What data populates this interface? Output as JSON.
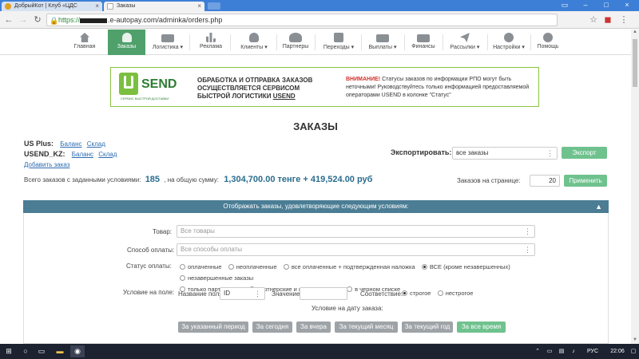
{
  "browser": {
    "tabs": [
      {
        "title": "ДобрыйКот | Клуб «ЦДС",
        "active": false
      },
      {
        "title": "Заказы",
        "active": true
      }
    ],
    "url_scheme": "https://",
    "url_rest": ".e-autopay.com/adminka/orders.php"
  },
  "nav": [
    {
      "label": "Главная",
      "icon": "home-icon",
      "active": false
    },
    {
      "label": "Заказы",
      "icon": "cart-icon",
      "active": true
    },
    {
      "label": "Логистика ▾",
      "icon": "truck-icon",
      "active": false
    },
    {
      "label": "Реклама",
      "icon": "bar-chart-icon",
      "active": false
    },
    {
      "label": "Клиенты ▾",
      "icon": "user-icon",
      "active": false
    },
    {
      "label": "Партнеры",
      "icon": "users-icon",
      "active": false
    },
    {
      "label": "Переходы ▾",
      "icon": "share-icon",
      "active": false
    },
    {
      "label": "Выплаты ▾",
      "icon": "credit-card-icon",
      "active": false
    },
    {
      "label": "Финансы",
      "icon": "money-icon",
      "active": false
    },
    {
      "label": "Рассылки ▾",
      "icon": "send-icon",
      "active": false
    },
    {
      "label": "Настройки ▾",
      "icon": "gear-icon",
      "active": false
    },
    {
      "label": "Помощь",
      "icon": "help-icon",
      "active": false
    }
  ],
  "banner": {
    "logo_text": "SEND",
    "logo_sub": "СЕРВИС БЫСТРОЙ ДОСТАВКИ",
    "main_line1": "ОБРАБОТКА И ОТПРАВКА ЗАКАЗОВ",
    "main_line2": "ОСУЩЕСТВЛЯЕТСЯ СЕРВИСОМ",
    "main_line3": "БЫСТРОЙ ЛОГИСТИКИ",
    "main_usend": "USEND",
    "warn_title": "ВНИМАНИЕ!",
    "warn_text": " Статусы заказов по информации РПО могут быть неточными! Руководствуйтесь только информацией предоставляемой операторами USEND в колонке \"Статус\""
  },
  "page": {
    "title": "ЗАКАЗЫ",
    "us_plus_label": "US Plus:",
    "usend_kz_label": "USEND_KZ:",
    "balance": "Баланс",
    "warehouse": "Склад",
    "add_order": "Добавить заказ",
    "export_label": "Экспортировать:",
    "export_value": "все заказы",
    "export_button": "Экспорт",
    "totals_prefix": "Всего заказов с заданными условиями:",
    "totals_count": "185",
    "totals_mid": ", на общую сумму:",
    "totals_sum": "1,304,700.00 тенге + 419,524.00 руб",
    "per_page_label": "Заказов на странице:",
    "per_page_value": "20",
    "apply_button": "Применить"
  },
  "filter": {
    "header": "Отображать заказы, удовлетворяющие следующим условиям:",
    "product_label": "Товар:",
    "product_placeholder": "Все товары",
    "payment_label": "Способ оплаты:",
    "payment_placeholder": "Все способы оплаты",
    "status_label": "Статус оплаты:",
    "status_options": [
      {
        "label": "оплаченные",
        "checked": false
      },
      {
        "label": "неоплаченные",
        "checked": false
      },
      {
        "label": "все оплаченные + подтвержденная наложка",
        "checked": false
      },
      {
        "label": "ВСЕ (кроме незавершенных)",
        "checked": true
      },
      {
        "label": "незавершенные заказы",
        "checked": false
      },
      {
        "label": "только партнерские",
        "checked": false
      },
      {
        "label": "партнерские и непартнерские",
        "checked": false
      },
      {
        "label": "в черном списке",
        "checked": false
      }
    ],
    "field_cond_label": "Условие на поле:",
    "field_name_label": "Название поля",
    "field_name_value": "ID",
    "value_label": "Значение",
    "match_label": "Соответствие:",
    "match_options": [
      {
        "label": "строгое",
        "checked": true
      },
      {
        "label": "нестрогое",
        "checked": false
      }
    ],
    "date_cond_label": "Условие на дату заказа:",
    "date_buttons": [
      {
        "label": "За указанный период",
        "active": false
      },
      {
        "label": "За сегодня",
        "active": false
      },
      {
        "label": "За вчера",
        "active": false
      },
      {
        "label": "За текущий месяц",
        "active": false
      },
      {
        "label": "За текущий год",
        "active": false
      },
      {
        "label": "За все время",
        "active": true
      }
    ]
  },
  "taskbar": {
    "lang": "РУС",
    "time": "22:06"
  },
  "colors": {
    "accent_green": "#4fa06a",
    "filter_header": "#4b7d94",
    "totals_blue": "#2b6c8f",
    "warning_red": "#d0322b"
  }
}
